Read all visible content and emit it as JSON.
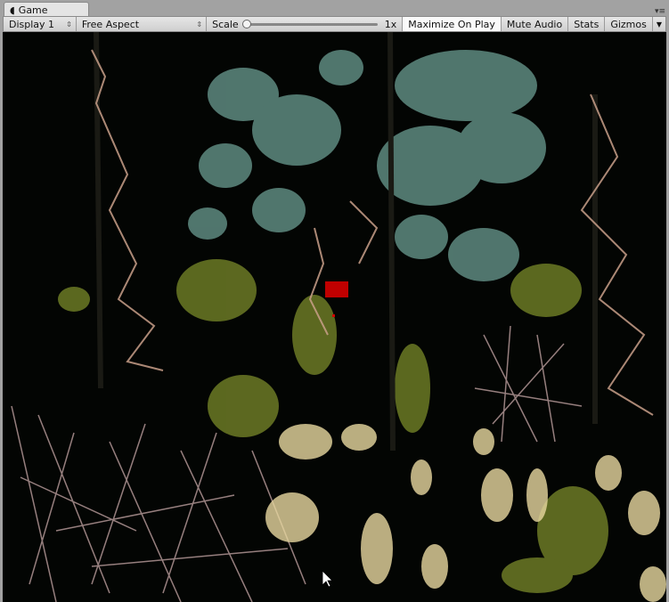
{
  "tab": {
    "title": "Game",
    "icon": "unity-game-icon"
  },
  "toolbar": {
    "display": "Display 1",
    "aspect": "Free Aspect",
    "scale_label": "Scale",
    "scale_value": "1x",
    "scale_fraction": 0,
    "maximize": "Maximize On Play",
    "mute": "Mute Audio",
    "stats": "Stats",
    "gizmos": "Gizmos"
  },
  "colors": {
    "teal_foliage": "#5e8a80",
    "yellow_foliage": "#8a9a30",
    "dry_branches": "#c9a08a",
    "grass": "#e8d8a0",
    "red_marker": "#c00000"
  }
}
